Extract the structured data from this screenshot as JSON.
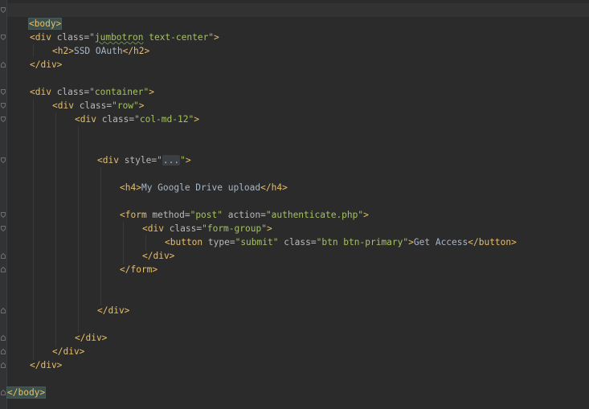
{
  "editor": {
    "lines": {
      "body_open": "<body>",
      "jumbotron_open_a": "<div ",
      "jumbotron_attr": "class=",
      "jumbotron_val_q1": "\"",
      "jumbotron_val_word": "jumbotron",
      "jumbotron_val_rest": " text-center\"",
      "jumbotron_close": ">",
      "h2_open": "<h2>",
      "h2_text": "SSD OAuth",
      "h2_close": "</h2>",
      "div_close_1": "</div>",
      "container_open": "<div ",
      "container_attr": "class=",
      "container_val": "\"container\"",
      "container_end": ">",
      "row_open": "<div ",
      "row_attr": "class=",
      "row_val": "\"row\"",
      "row_end": ">",
      "col_open": "<div ",
      "col_attr": "class=",
      "col_val": "\"col-md-12\"",
      "col_end": ">",
      "style_open": "<div ",
      "style_attr": "style=",
      "style_q1": "\"",
      "style_ellipsis": "...",
      "style_q2": "\"",
      "style_end": ">",
      "h4_open": "<h4>",
      "h4_text": "My Google Drive upload",
      "h4_close": "</h4>",
      "form_open": "<form ",
      "form_attr1": "method=",
      "form_val1": "\"post\"",
      "form_attr2": " action=",
      "form_val2": "\"authenticate.php\"",
      "form_end": ">",
      "fg_open": "<div ",
      "fg_attr": "class=",
      "fg_val": "\"form-group\"",
      "fg_end": ">",
      "btn_open": "<button ",
      "btn_attr1": "type=",
      "btn_val1": "\"submit\"",
      "btn_attr2": " class=",
      "btn_val2": "\"btn btn-primary\"",
      "btn_end": ">",
      "btn_text": "Get Access",
      "btn_close": "</button>",
      "fg_close": "</div>",
      "form_close": "</form>",
      "style_close": "</div>",
      "col_close": "</div>",
      "row_close": "</div>",
      "container_close": "</div>",
      "body_close": "</body>"
    }
  }
}
